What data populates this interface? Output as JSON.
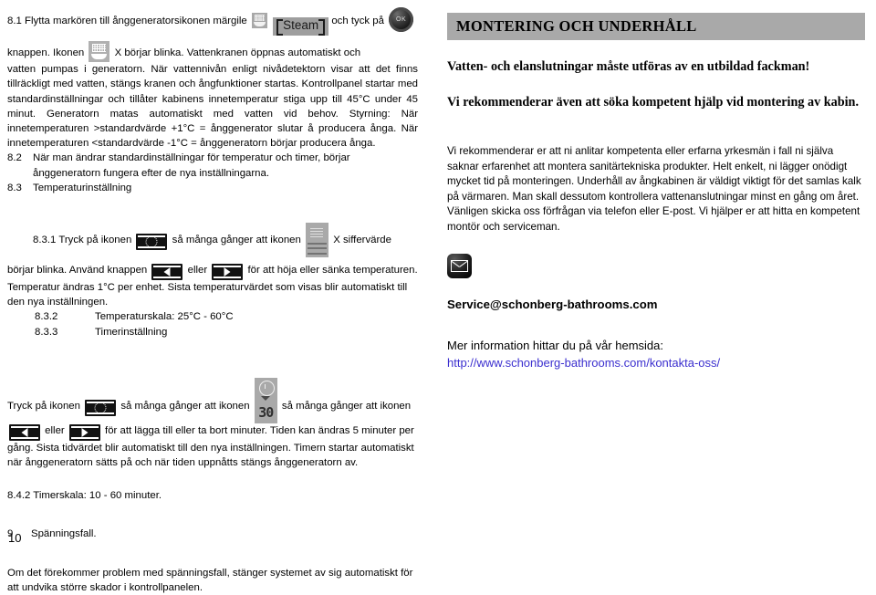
{
  "document": {
    "page_number": "10"
  },
  "left_column": {
    "s81": {
      "number": "8.1",
      "text_before_icons": "Flytta markören till ånggeneratorsikonen märgile",
      "steam_label": "Steam",
      "text_after_steam": "och tyck på",
      "ok_label": "OK",
      "line2_before_icon": "knappen. Ikonen",
      "line2_after_icon": "X börjar blinka. Vattenkranen öppnas automatiskt och",
      "body": "vatten pumpas i generatorn. När vattennivån enligt nivådetektorn visar att det finns tillräckligt med vatten, stängs kranen och ångfunktioner startas. Kontrollpanel startar med standardinställningar och tillåter kabinens innetemperatur stiga upp till 45°C under 45 minut. Generatorn matas automatiskt med vatten vid behov. Styrning: När innetemperaturen >standardvärde +1°C = ånggenerator slutar å producera ånga. När innetemperaturen <standardvärde -1°C = ånggeneratorn börjar producera ånga."
    },
    "s82": {
      "number": "8.2",
      "text": "När man ändrar standardinställningar för temperatur och timer, börjar ånggeneratorn fungera efter de nya inställningarna."
    },
    "s83": {
      "number": "8.3",
      "text": "Temperaturinställning"
    },
    "s831": {
      "number": "8.3.1",
      "t1": "Tryck på ikonen",
      "t2": "så många gånger att ikonen",
      "t3": "X siffervärde",
      "t4": "börjar blinka. Använd knappen",
      "t5": "eller",
      "t6": "för att höja eller sänka temperaturen.",
      "t7": "Temperatur ändras 1°C per enhet. Sista temperaturvärdet som visas blir automatiskt till den nya inställningen."
    },
    "s832": {
      "number": "8.3.2",
      "text": "Temperaturskala: 25°C - 60°C"
    },
    "s833": {
      "number": "8.3.3",
      "text": "Timerinställning"
    },
    "timer_para": {
      "t1": "Tryck på ikonen",
      "t2": "så många gånger att ikonen",
      "timer_digits": "30",
      "t3": "så många gånger att ikonen",
      "t4": "eller",
      "t5": "för att lägga till eller ta bort minuter. Tiden kan ändras 5 minuter per gång. Sista tidvärdet blir automatiskt till den nya inställningen. Timern startar automatiskt när ånggeneratorn sätts på och när tiden uppnåtts stängs ånggeneratorn av."
    },
    "s842": {
      "text": "8.4.2 Timerskala: 10 - 60 minuter."
    },
    "s9": {
      "number": "9",
      "title": "Spänningsfall.",
      "body": "Om det förekommer problem med spänningsfall, stänger systemet av sig automatiskt för att undvika större skador i kontrollpanelen."
    }
  },
  "right_column": {
    "heading": "MONTERING OCH UNDERHÅLL",
    "warning": "Vatten- och elanslutningar måste utföras av en utbildad fackman!",
    "recommend": "Vi rekommenderar även att söka kompetent hjälp vid montering av kabin.",
    "body": "Vi rekommenderar er att ni anlitar kompetenta eller erfarna yrkesmän i fall ni själva saknar erfarenhet att montera sanitärtekniska produkter. Helt enkelt, ni lägger onödigt mycket tid på monteringen. Underhåll av ångkabinen är väldigt viktigt för det samlas kalk på värmaren. Man skall dessutom kontrollera vattenanslutningar minst en gång om året. Vänligen skicka oss förfrågan via telefon eller E-post. Vi hjälper er att hitta en kompetent montör och serviceman.",
    "email": "Service@schonberg-bathrooms.com",
    "info_label": "Mer information hittar du på vår hemsida:",
    "url": "http://www.schonberg-bathrooms.com/kontakta-oss/"
  },
  "colors": {
    "heading_band": "#a9a9a9",
    "link": "#3b2fcf",
    "icon_grey": "#a9a9a9",
    "key_dark": "#121212"
  }
}
